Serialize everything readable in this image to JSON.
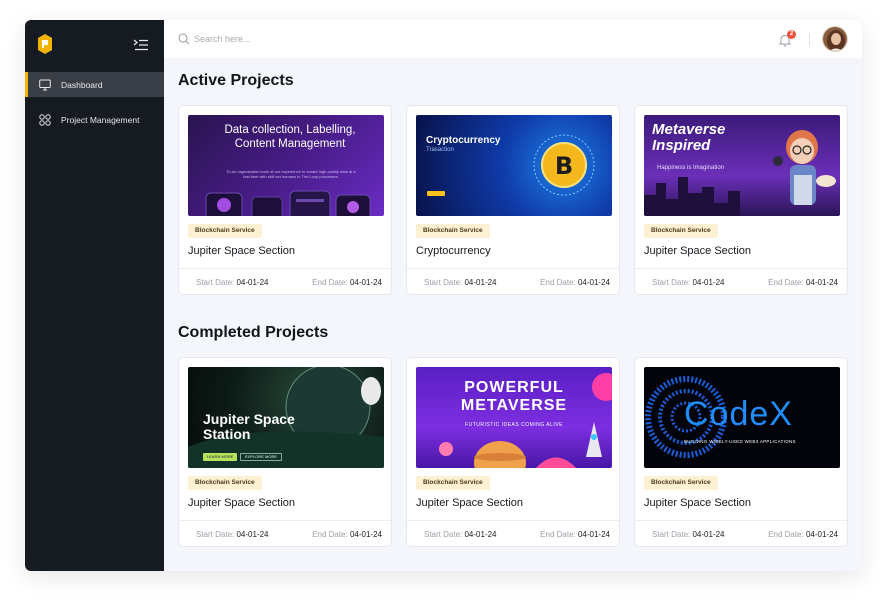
{
  "sidebar": {
    "items": [
      {
        "label": "Dashboard",
        "icon": "monitor-icon",
        "active": true
      },
      {
        "label": "Project Management",
        "icon": "grid-icon",
        "active": false
      }
    ]
  },
  "header": {
    "search_placeholder": "Search here...",
    "notification_count": "2"
  },
  "active": {
    "title": "Active Projects",
    "cards": [
      {
        "tag": "Blockchain Service",
        "title": "Jupiter Space Section",
        "start_label": "Start Date:",
        "start": "04-01-24",
        "end_label": "End Date:",
        "end": "04-01-24",
        "thumb": {
          "heading": "Data collection, Labelling, Content Management",
          "sub": "To-do organization tools of our experience to create high quality data at a fast time with skill set humans in The Loop processes."
        }
      },
      {
        "tag": "Blockchain Service",
        "title": "Cryptocurrency",
        "start_label": "Start Date:",
        "start": "04-01-24",
        "end_label": "End Date:",
        "end": "04-01-24",
        "thumb": {
          "heading": "Cryptocurrency",
          "sub": "Trasaction",
          "coin": "B"
        }
      },
      {
        "tag": "Blockchain Service",
        "title": "Jupiter Space Section",
        "start_label": "Start Date:",
        "start": "04-01-24",
        "end_label": "End Date:",
        "end": "04-01-24",
        "thumb": {
          "heading": "Metaverse Inspired",
          "sub": "Happiness is Imagination"
        }
      }
    ]
  },
  "completed": {
    "title": "Completed Projects",
    "cards": [
      {
        "tag": "Blockchain Service",
        "title": "Jupiter Space Section",
        "start_label": "Start Date:",
        "start": "04-01-24",
        "end_label": "End Date:",
        "end": "04-01-24",
        "thumb": {
          "heading": "Jupiter Space Station",
          "btn1": "LEARN MORE",
          "btn2": "EXPLORE MORE"
        }
      },
      {
        "tag": "Blockchain Service",
        "title": "Jupiter Space Section",
        "start_label": "Start Date:",
        "start": "04-01-24",
        "end_label": "End Date:",
        "end": "04-01-24",
        "thumb": {
          "heading": "POWERFUL METAVERSE",
          "sub": "FUTURISTIC IDEAS COMING ALIVE"
        }
      },
      {
        "tag": "Blockchain Service",
        "title": "Jupiter Space Section",
        "start_label": "Start Date:",
        "start": "04-01-24",
        "end_label": "End Date:",
        "end": "04-01-24",
        "thumb": {
          "heading": "CodeX",
          "sub": "BUILDING WIDELY-USED WEB3 APPLICATIONS"
        }
      }
    ]
  },
  "colors": {
    "accent": "#f5b400",
    "sidebar": "#161b22",
    "tag_bg": "#fdf0d3",
    "badge": "#f0523d"
  }
}
